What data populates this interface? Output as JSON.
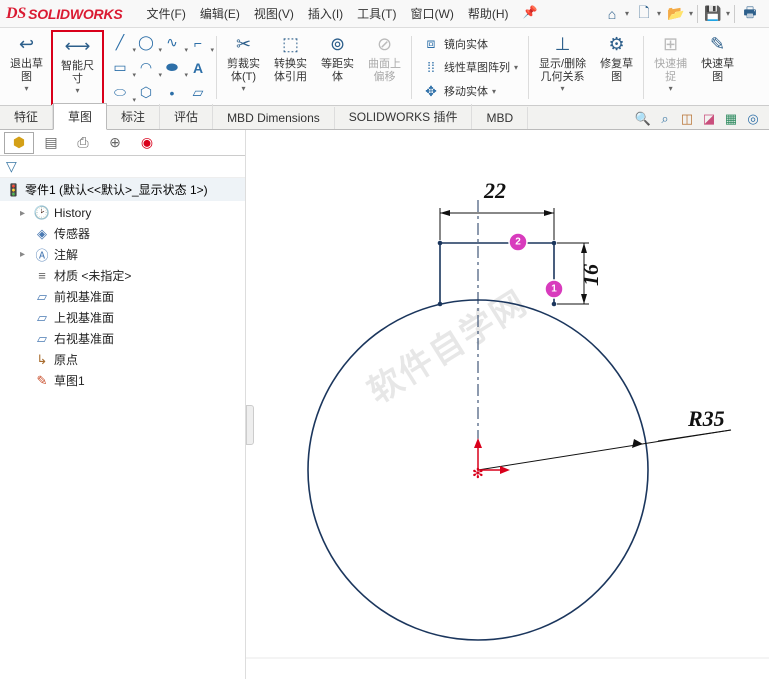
{
  "logo": {
    "prefix": "DS",
    "text": "SOLIDWORKS"
  },
  "menu": {
    "file": "文件(F)",
    "edit": "编辑(E)",
    "view": "视图(V)",
    "insert": "插入(I)",
    "tools": "工具(T)",
    "window": "窗口(W)",
    "help": "帮助(H)"
  },
  "ribbon": {
    "exit_sketch": "退出草\n图",
    "smart_dim": "智能尺\n寸",
    "trim": "剪裁实\n体(T)",
    "convert": "转换实\n体引用",
    "offset": "等距实\n体",
    "surface_offset": "曲面上\n偏移",
    "mirror": "镜向实体",
    "linear_pattern": "线性草图阵列",
    "move": "移动实体",
    "show_rel": "显示/删除\n几何关系",
    "repair": "修复草\n图",
    "quick_snap": "快速捕\n捉",
    "quick_sketch": "快速草\n图"
  },
  "tabs": {
    "feature": "特征",
    "sketch": "草图",
    "annotate": "标注",
    "evaluate": "评估",
    "mbd": "MBD Dimensions",
    "addins": "SOLIDWORKS 插件",
    "mbd2": "MBD"
  },
  "tree": {
    "root": "零件1  (默认<<默认>_显示状态 1>)",
    "history": "History",
    "sensors": "传感器",
    "annotations": "注解",
    "material": "材质 <未指定>",
    "front": "前视基准面",
    "top": "上视基准面",
    "right": "右视基准面",
    "origin": "原点",
    "sketch1": "草图1"
  },
  "dims": {
    "width": "22",
    "height": "16",
    "radius": "R35"
  },
  "markers": {
    "one": "1",
    "two": "2"
  },
  "watermark": "软件自学网"
}
